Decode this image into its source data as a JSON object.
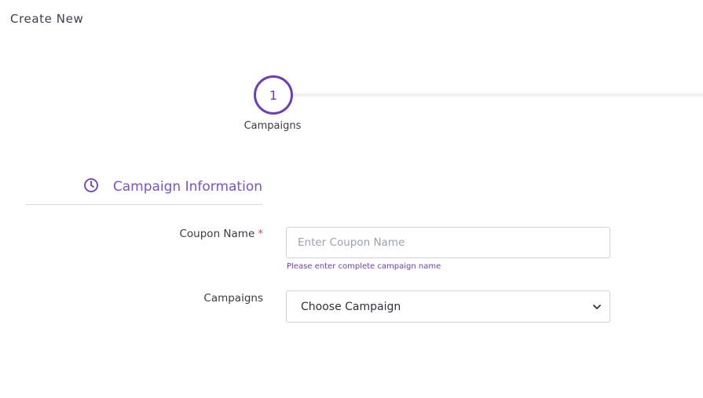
{
  "page": {
    "heading": "Create New"
  },
  "stepper": {
    "steps": [
      {
        "number": "1",
        "label": "Campaigns",
        "active": true
      }
    ],
    "accent_color": "#6c3fb5"
  },
  "section": {
    "title": "Campaign Information",
    "icon": "clock-icon"
  },
  "form": {
    "coupon_name": {
      "label": "Coupon Name",
      "required_mark": "*",
      "value": "",
      "placeholder": "Enter Coupon Name",
      "help_text": "Please enter complete campaign name"
    },
    "campaigns": {
      "label": "Campaigns",
      "selected": "Choose Campaign",
      "icon": "chevron-down-icon"
    }
  },
  "colors": {
    "accent": "#6c3fb5",
    "section_title": "#7b52c9",
    "required": "#e0475b"
  }
}
